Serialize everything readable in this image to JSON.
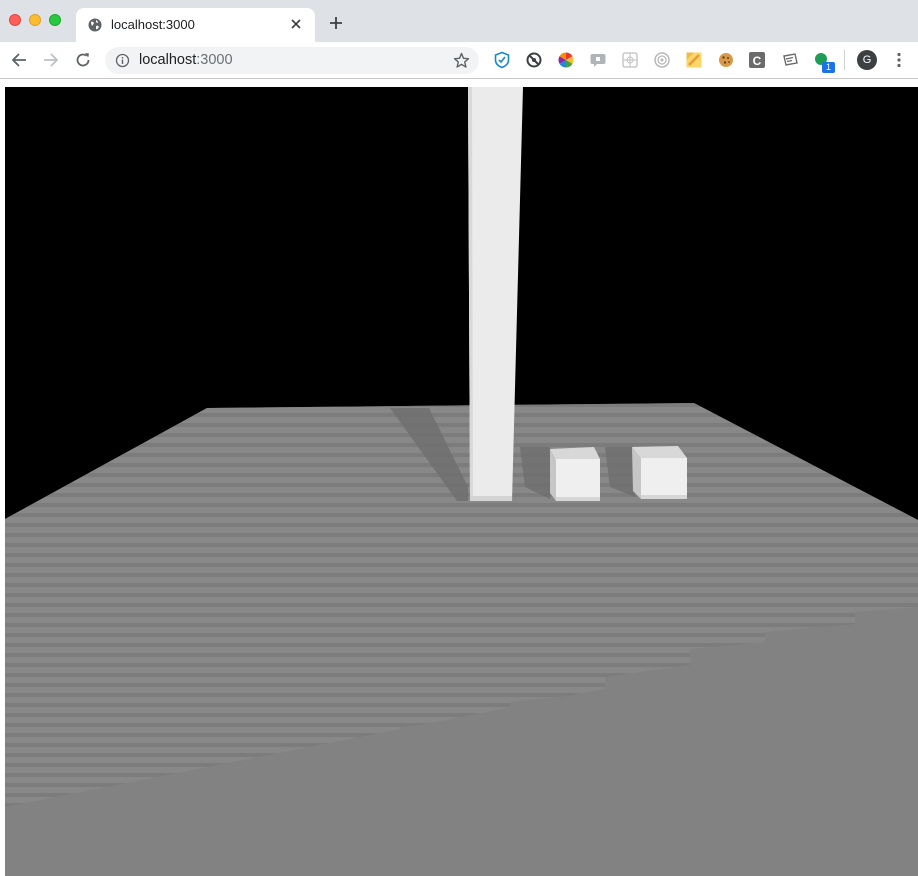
{
  "browser": {
    "tab": {
      "title": "localhost:3000",
      "favicon": "globe-icon"
    },
    "new_tab_label": "+",
    "address": {
      "host": "localhost",
      "port": ":3000"
    },
    "profile_initial": "G",
    "extensions": [
      "shield-extension-icon",
      "sync-extension-icon",
      "color-wheel-extension-icon",
      "chat-extension-icon",
      "grid-extension-icon",
      "target-extension-icon",
      "note-extension-icon",
      "cookie-extension-icon",
      "c-extension-icon",
      "card-extension-icon",
      "green-dot-extension-icon"
    ],
    "extension_badge": "1",
    "extension_letter": "C"
  },
  "scene": {
    "background_color": "#000000",
    "floor_color": "#808080",
    "object_color": "#eeeeee",
    "objects": [
      "tall-pillar",
      "cube",
      "cube"
    ]
  }
}
